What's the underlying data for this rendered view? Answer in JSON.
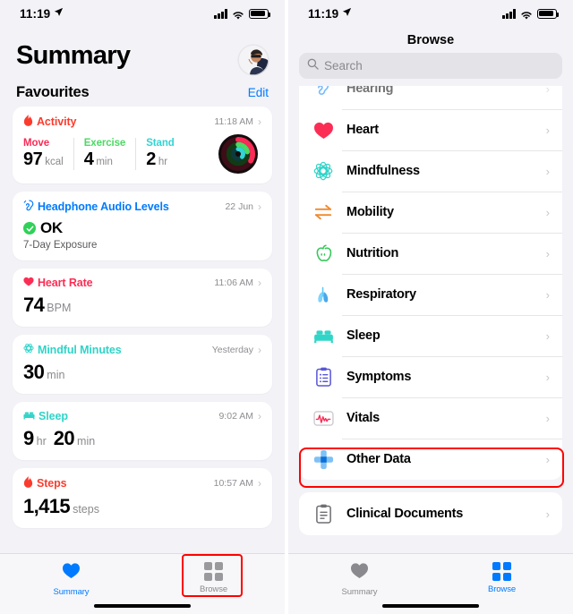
{
  "status_bar": {
    "time": "11:19",
    "location_icon": "location-arrow-icon",
    "cellular_icon": "cellular-bars-icon",
    "wifi_icon": "wifi-icon",
    "battery_icon": "battery-full-icon"
  },
  "colors": {
    "accent_blue": "#007aff",
    "activity_red": "#fa3c2d",
    "move_red": "#fa2b56",
    "exercise_green": "#4cd964",
    "stand_cyan": "#31d4d4",
    "heart_red": "#fc2d55",
    "mindful_teal": "#2fd4c8",
    "sleep_teal": "#30d5c8",
    "highlight_red": "#ff0000",
    "screen_bg": "#f2f2f7",
    "card_bg": "#ffffff"
  },
  "summary_screen": {
    "page_title": "Summary",
    "avatar": "user-profile-avatar",
    "section_title": "Favourites",
    "edit_label": "Edit",
    "cards": [
      {
        "id": "activity",
        "icon": "flame-icon",
        "title": "Activity",
        "title_color": "#fa3c2d",
        "timestamp": "11:18 AM",
        "rings": "activity-rings",
        "stats": [
          {
            "label": "Move",
            "label_color": "#fa2b56",
            "value": "97",
            "unit": "kcal"
          },
          {
            "label": "Exercise",
            "label_color": "#4cd964",
            "value": "4",
            "unit": "min"
          },
          {
            "label": "Stand",
            "label_color": "#31d4d4",
            "value": "2",
            "unit": "hr"
          }
        ]
      },
      {
        "id": "headphone-audio-levels",
        "icon": "ear-audio-icon",
        "title": "Headphone Audio Levels",
        "title_color": "#007aff",
        "timestamp": "22 Jun",
        "status_badge": "check-circle-icon",
        "status_text": "OK",
        "subtitle": "7-Day Exposure"
      },
      {
        "id": "heart-rate",
        "icon": "heart-icon",
        "title": "Heart Rate",
        "title_color": "#fc2d55",
        "timestamp": "11:06 AM",
        "value": "74",
        "unit": "BPM"
      },
      {
        "id": "mindful-minutes",
        "icon": "mindfulness-icon",
        "title": "Mindful Minutes",
        "title_color": "#2fd4c8",
        "timestamp": "Yesterday",
        "value": "30",
        "unit": "min"
      },
      {
        "id": "sleep",
        "icon": "bed-icon",
        "title": "Sleep",
        "title_color": "#30d5c8",
        "timestamp": "9:02 AM",
        "value": "9",
        "unit": "hr",
        "value2": "20",
        "unit2": "min"
      },
      {
        "id": "steps",
        "icon": "flame-icon",
        "title": "Steps",
        "title_color": "#fa3c2d",
        "timestamp": "10:57 AM",
        "value": "1,415",
        "unit": "steps"
      }
    ]
  },
  "browse_screen": {
    "nav_title": "Browse",
    "search": {
      "placeholder": "Search",
      "icon": "search-icon"
    },
    "categories": [
      {
        "id": "hearing",
        "label": "Hearing",
        "icon": "ear-icon",
        "partially_scrolled": true
      },
      {
        "id": "heart",
        "label": "Heart",
        "icon": "heart-icon"
      },
      {
        "id": "mindfulness",
        "label": "Mindfulness",
        "icon": "mindfulness-icon"
      },
      {
        "id": "mobility",
        "label": "Mobility",
        "icon": "mobility-arrows-icon"
      },
      {
        "id": "nutrition",
        "label": "Nutrition",
        "icon": "apple-icon"
      },
      {
        "id": "respiratory",
        "label": "Respiratory",
        "icon": "lungs-icon"
      },
      {
        "id": "sleep",
        "label": "Sleep",
        "icon": "bed-icon"
      },
      {
        "id": "symptoms",
        "label": "Symptoms",
        "icon": "clipboard-list-icon"
      },
      {
        "id": "vitals",
        "label": "Vitals",
        "icon": "waveform-icon"
      },
      {
        "id": "other-data",
        "label": "Other Data",
        "icon": "plus-cross-icon",
        "highlighted": true
      }
    ],
    "secondary_group": [
      {
        "id": "clinical-documents",
        "label": "Clinical Documents",
        "icon": "document-clipboard-icon"
      }
    ],
    "chevron": "chevron-right-icon"
  },
  "tab_bar": {
    "summary": {
      "label": "Summary",
      "icon": "heart-icon"
    },
    "browse": {
      "label": "Browse",
      "icon": "grid-squares-icon"
    }
  },
  "annotations": [
    {
      "target": "browse-tab-left-screen",
      "shape": "rectangle",
      "color": "#ff0000"
    },
    {
      "target": "other-data-row",
      "shape": "rectangle",
      "color": "#ff0000"
    }
  ]
}
